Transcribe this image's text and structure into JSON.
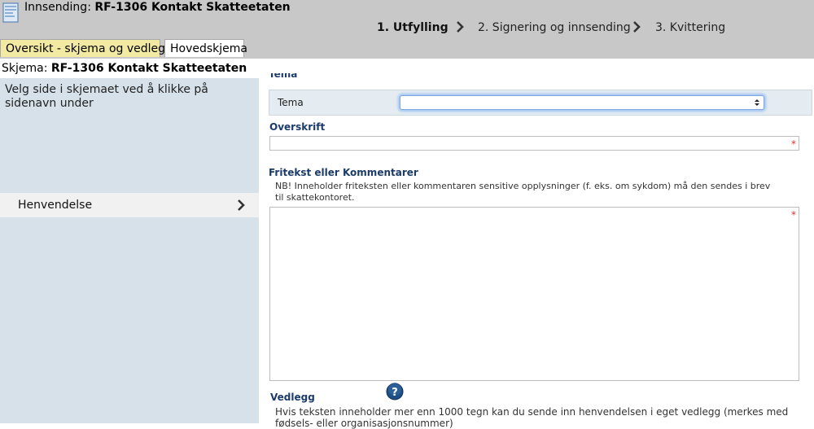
{
  "header": {
    "title_prefix": "Innsending:",
    "title_form": "RF-1306 Kontakt Skatteetaten",
    "steps": [
      "1. Utfylling",
      "2. Signering og innsending",
      "3. Kvittering"
    ]
  },
  "tabs": [
    "Oversikt - skjema og vedlegg",
    "Hovedskjema"
  ],
  "skjema": {
    "prefix": "Skjema:",
    "name": "RF-1306 Kontakt Skatteetaten"
  },
  "sidebar": {
    "instruction": "Velg side i skjemaet ved å klikke på sidenavn under",
    "items": [
      {
        "label": "Henvendelse"
      }
    ]
  },
  "form": {
    "tema_heading": "Tema",
    "tema_label": "Tema",
    "tema_value": "",
    "overskrift_heading": "Overskrift",
    "overskrift_value": "",
    "required_marker": "*",
    "fritekst_heading": "Fritekst eller Kommentarer",
    "fritekst_note": "NB! Inneholder friteksten eller kommentaren sensitive opplysninger (f. eks. om sykdom) må den sendes i brev til skattekontoret.",
    "fritekst_value": "",
    "vedlegg_heading": "Vedlegg",
    "vedlegg_text": "Hvis teksten inneholder mer enn 1000 tegn kan du sende inn henvendelsen i eget vedlegg (merkes med fødsels- eller organisasjonsnummer)"
  },
  "colors": {
    "topbar": "#c8c8c8",
    "sidebar": "#d6e1e9",
    "tab_overview": "#f2e9a2",
    "heading_blue": "#1b3b6a",
    "help_icon": "#1d4f84",
    "required": "#e03030"
  },
  "icons": [
    "document-icon",
    "chevron-right-icon",
    "help-icon",
    "select-arrows-icon"
  ]
}
